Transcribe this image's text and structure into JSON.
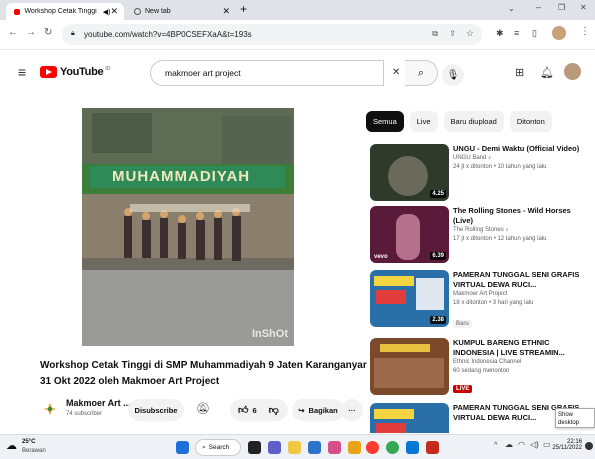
{
  "browser": {
    "tabs": [
      {
        "title": "Workshop Cetak Tinggi di SM"
      },
      {
        "title": "New tab"
      }
    ],
    "new_tab": "+",
    "url": "youtube.com/watch?v=4BP0CSEFXaA&t=193s"
  },
  "youtube": {
    "logo": "YouTube",
    "logo_region": "ID",
    "search": {
      "value": "makmoer art project"
    },
    "clear_symbol": "✕"
  },
  "video": {
    "watermark": "InShOt",
    "banner_text": "MUHAMMADIYAH",
    "title": "Workshop Cetak Tinggi di SMP Muhammadiyah 9 Jaten Karanganyar 31 Okt 2022 oleh Makmoer Art Project",
    "channel": {
      "name": "Makmoer Art ...",
      "subscribers": "74 subscriber"
    },
    "subscribe_label": "Disubscribe",
    "likes": "6",
    "share_label": "Bagikan",
    "more_label": "···"
  },
  "chips": [
    "Semua",
    "Live",
    "Baru diupload",
    "Ditonton"
  ],
  "recommendations": [
    {
      "title": "UNGU - Demi Waktu (Official Video)",
      "channel": "UNGU Band ♪",
      "stats": "24 jt x ditonton • 10 tahun yang lalu",
      "duration": "4.25",
      "badge": "",
      "thumb_color": "#2f3a2a"
    },
    {
      "title": "The Rolling Stones - Wild Horses (Live)",
      "channel": "The Rolling Stones ♪",
      "stats": "17 jt x ditonton • 12 tahun yang lalu",
      "duration": "6.39",
      "badge": "vevo",
      "thumb_color": "#5a1a3a"
    },
    {
      "title": "PAMERAN TUNGGAL SENI GRAFIS VIRTUAL DEWA RUCI...",
      "channel": "Makmoer Art Project",
      "stats": "18 x ditonton • 3 hari yang lalu",
      "duration": "2.38",
      "badge": "Baru",
      "thumb_color": "#2a6fa8"
    },
    {
      "title": "KUMPUL BARENG ETHNIC INDONESIA | LIVE STREAMIN...",
      "channel": "Ethnic Indonesia Channel",
      "stats": "60 sedang menonton",
      "duration": "",
      "badge": "LIVE",
      "thumb_color": "#7a4a2a"
    },
    {
      "title": "PAMERAN TUNGGAL SENI GRAFIS VIRTUAL DEWA RUCI...",
      "channel": "",
      "stats": "",
      "duration": "",
      "badge": "",
      "thumb_color": "#2a6fa8"
    }
  ],
  "show_desktop": "Show desktop",
  "taskbar": {
    "weather_temp": "25°C",
    "weather_desc": "Berawan",
    "search_label": "Search",
    "time": "22:16",
    "date": "25/11/2022"
  },
  "colors": {
    "youtube_red": "#ff0000",
    "accent_blue": "#065fd4"
  }
}
